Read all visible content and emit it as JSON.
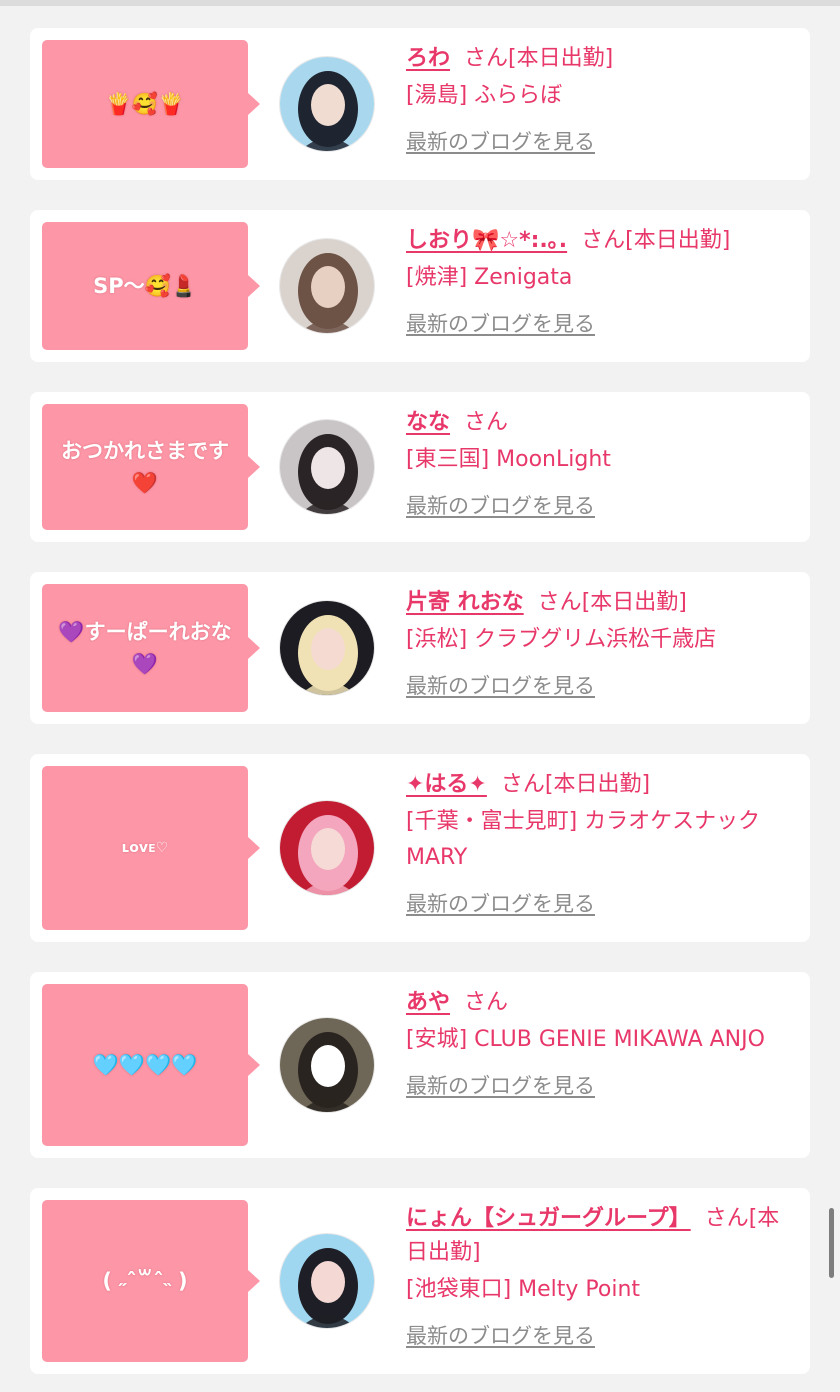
{
  "colors": {
    "accent": "#e8386a",
    "bubble": "#fd97a7",
    "link_gray": "#8c8c8c"
  },
  "entries": [
    {
      "bubble_text": "🍟🥰🍟",
      "bubble_small": false,
      "name": "ろわ",
      "san": "さん",
      "status": "[本日出勤]",
      "shop": "[湯島] ふららぼ",
      "blog": "最新のブログを見る",
      "avatar_palette": [
        "#a9d8ee",
        "#1e2430",
        "#f1dcd2"
      ]
    },
    {
      "bubble_text": "SP〜🥰💄",
      "bubble_small": false,
      "name": "しおり🎀☆*:.｡.",
      "san": "さん",
      "status": "[本日出勤]",
      "shop": "[焼津] Zenigata",
      "blog": "最新のブログを見る",
      "avatar_palette": [
        "#d9d2cd",
        "#6d5246",
        "#e7cfc2"
      ]
    },
    {
      "bubble_text": "おつかれさまです❤️",
      "bubble_small": false,
      "name": "なな",
      "san": "さん",
      "status": "",
      "shop": "[東三国] MoonLight",
      "blog": "最新のブログを見る",
      "avatar_palette": [
        "#c9c4c6",
        "#2a2426",
        "#eee5e6"
      ]
    },
    {
      "bubble_text": "💜すーぱーれおな💜",
      "bubble_small": false,
      "name": "片寄 れおな",
      "san": "さん",
      "status": "[本日出勤]",
      "shop": "[浜松] クラブグリム浜松千歳店",
      "blog": "最新のブログを見る",
      "avatar_palette": [
        "#1c1c22",
        "#f0e2b4",
        "#f4dad0"
      ]
    },
    {
      "bubble_text": "ʟᴏᴠᴇ♡",
      "bubble_small": true,
      "name": "✦はる✦",
      "san": "さん",
      "status": "[本日出勤]",
      "shop": "[千葉・富士見町] カラオケスナック MARY",
      "blog": "最新のブログを見る",
      "avatar_palette": [
        "#c21c32",
        "#f3a6bd",
        "#f6dad6"
      ]
    },
    {
      "bubble_text": "🩵🩵🩵🩵",
      "bubble_small": false,
      "name": "あや",
      "san": "さん",
      "status": "",
      "shop": "[安城] CLUB GENIE MIKAWA ANJO",
      "blog": "最新のブログを見る",
      "avatar_palette": [
        "#6e6656",
        "#2a2420",
        "#ffffff"
      ]
    },
    {
      "bubble_text": "( ˶ˆ꒳ˆ˵ )",
      "bubble_small": false,
      "name": "にょん【シュガーグループ】",
      "san": "さん",
      "status": "[本日出勤]",
      "shop": "[池袋東口] Melty Point",
      "blog": "最新のブログを見る",
      "avatar_palette": [
        "#9fd6f0",
        "#1e1e26",
        "#f4d8d4"
      ]
    }
  ]
}
